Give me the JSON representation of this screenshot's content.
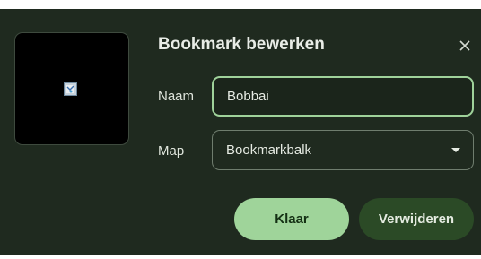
{
  "dialog": {
    "title": "Bookmark bewerken",
    "close_icon": "close-icon",
    "favicon_icon": "bookmark-favicon-icon"
  },
  "form": {
    "name_label": "Naam",
    "name_value": "Bobbai",
    "folder_label": "Map",
    "folder_value": "Bookmarkbalk",
    "folder_icon": "chevron-down-icon"
  },
  "buttons": {
    "done_label": "Klaar",
    "remove_label": "Verwijderen"
  },
  "colors": {
    "dialog_bg": "#1f2a1f",
    "accent": "#9fd49a",
    "accent_dark": "#2b4a26"
  }
}
